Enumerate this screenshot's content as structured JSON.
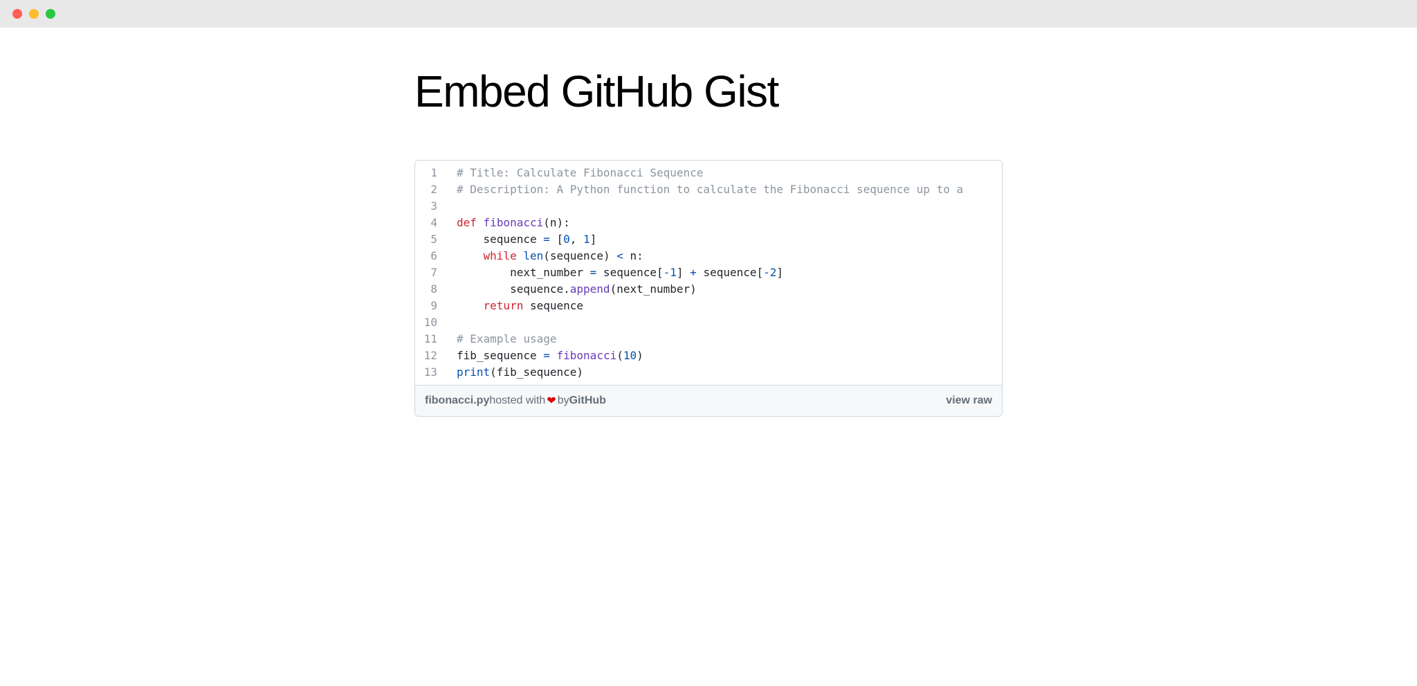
{
  "window": {
    "traffic_lights": [
      "close",
      "minimize",
      "zoom"
    ]
  },
  "page_title": "Embed GitHub Gist",
  "gist": {
    "filename": "fibonacci.py",
    "hosted_text_1": " hosted with ",
    "heart": "❤",
    "hosted_text_2": " by ",
    "github_text": "GitHub",
    "view_raw": "view raw",
    "lines": [
      {
        "n": "1",
        "tokens": [
          {
            "cls": "tok-comment",
            "t": "# Title: Calculate Fibonacci Sequence"
          }
        ]
      },
      {
        "n": "2",
        "tokens": [
          {
            "cls": "tok-comment",
            "t": "# Description: A Python function to calculate the Fibonacci sequence up to a"
          }
        ]
      },
      {
        "n": "3",
        "tokens": []
      },
      {
        "n": "4",
        "tokens": [
          {
            "cls": "tok-keyword",
            "t": "def"
          },
          {
            "cls": "tok-plain",
            "t": " "
          },
          {
            "cls": "tok-func",
            "t": "fibonacci"
          },
          {
            "cls": "tok-plain",
            "t": "("
          },
          {
            "cls": "tok-plain",
            "t": "n"
          },
          {
            "cls": "tok-plain",
            "t": "):"
          }
        ]
      },
      {
        "n": "5",
        "tokens": [
          {
            "cls": "tok-plain",
            "t": "    "
          },
          {
            "cls": "tok-plain",
            "t": "sequence"
          },
          {
            "cls": "tok-plain",
            "t": " "
          },
          {
            "cls": "tok-op",
            "t": "="
          },
          {
            "cls": "tok-plain",
            "t": " ["
          },
          {
            "cls": "tok-num",
            "t": "0"
          },
          {
            "cls": "tok-plain",
            "t": ", "
          },
          {
            "cls": "tok-num",
            "t": "1"
          },
          {
            "cls": "tok-plain",
            "t": "]"
          }
        ]
      },
      {
        "n": "6",
        "tokens": [
          {
            "cls": "tok-plain",
            "t": "    "
          },
          {
            "cls": "tok-keyword",
            "t": "while"
          },
          {
            "cls": "tok-plain",
            "t": " "
          },
          {
            "cls": "tok-builtin",
            "t": "len"
          },
          {
            "cls": "tok-plain",
            "t": "(sequence) "
          },
          {
            "cls": "tok-op",
            "t": "<"
          },
          {
            "cls": "tok-plain",
            "t": " n:"
          }
        ]
      },
      {
        "n": "7",
        "tokens": [
          {
            "cls": "tok-plain",
            "t": "        next_number "
          },
          {
            "cls": "tok-op",
            "t": "="
          },
          {
            "cls": "tok-plain",
            "t": " sequence["
          },
          {
            "cls": "tok-op",
            "t": "-"
          },
          {
            "cls": "tok-num",
            "t": "1"
          },
          {
            "cls": "tok-plain",
            "t": "] "
          },
          {
            "cls": "tok-op",
            "t": "+"
          },
          {
            "cls": "tok-plain",
            "t": " sequence["
          },
          {
            "cls": "tok-op",
            "t": "-"
          },
          {
            "cls": "tok-num",
            "t": "2"
          },
          {
            "cls": "tok-plain",
            "t": "]"
          }
        ]
      },
      {
        "n": "8",
        "tokens": [
          {
            "cls": "tok-plain",
            "t": "        sequence."
          },
          {
            "cls": "tok-func",
            "t": "append"
          },
          {
            "cls": "tok-plain",
            "t": "(next_number)"
          }
        ]
      },
      {
        "n": "9",
        "tokens": [
          {
            "cls": "tok-plain",
            "t": "    "
          },
          {
            "cls": "tok-keyword",
            "t": "return"
          },
          {
            "cls": "tok-plain",
            "t": " sequence"
          }
        ]
      },
      {
        "n": "10",
        "tokens": []
      },
      {
        "n": "11",
        "tokens": [
          {
            "cls": "tok-comment",
            "t": "# Example usage"
          }
        ]
      },
      {
        "n": "12",
        "tokens": [
          {
            "cls": "tok-plain",
            "t": "fib_sequence "
          },
          {
            "cls": "tok-op",
            "t": "="
          },
          {
            "cls": "tok-plain",
            "t": " "
          },
          {
            "cls": "tok-func",
            "t": "fibonacci"
          },
          {
            "cls": "tok-plain",
            "t": "("
          },
          {
            "cls": "tok-num",
            "t": "10"
          },
          {
            "cls": "tok-plain",
            "t": ")"
          }
        ]
      },
      {
        "n": "13",
        "tokens": [
          {
            "cls": "tok-builtin",
            "t": "print"
          },
          {
            "cls": "tok-plain",
            "t": "(fib_sequence)"
          }
        ]
      }
    ]
  }
}
